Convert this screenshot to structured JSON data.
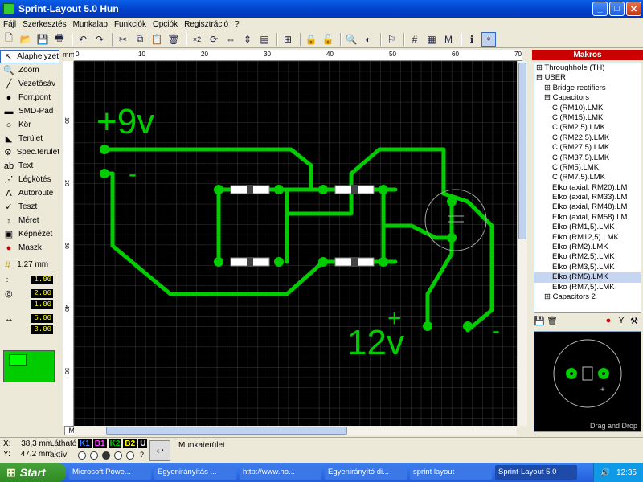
{
  "window": {
    "title": "Sprint-Layout 5.0 Hun",
    "min": "_",
    "max": "□",
    "close": "✕"
  },
  "menu": [
    "Fájl",
    "Szerkesztés",
    "Munkalap",
    "Funkciók",
    "Opciók",
    "Regisztráció",
    "?"
  ],
  "toolbar": {
    "icons": [
      "new-icon",
      "open-icon",
      "save-icon",
      "print-icon",
      "sep",
      "undo-icon",
      "redo-icon",
      "sep",
      "cut-icon",
      "copy-icon",
      "paste-icon",
      "delete-icon",
      "sep",
      "duplicate-icon",
      "rotate-icon",
      "mirror-h-icon",
      "mirror-v-icon",
      "align-icon",
      "sep",
      "group-icon",
      "sep",
      "lock-icon",
      "unlock-icon",
      "sep",
      "zoom-icon",
      "contrast-icon",
      "sep",
      "drc-icon",
      "sep",
      "grid-icon",
      "drc-report-icon",
      "layer-icon",
      "sep",
      "info-icon",
      "connect-icon"
    ],
    "x2_label": "×2"
  },
  "tools": [
    {
      "label": "Alaphelyzet",
      "icon": "pointer-icon",
      "glyph": "↖"
    },
    {
      "label": "Zoom",
      "icon": "zoom-tool-icon",
      "glyph": "🔍"
    },
    {
      "label": "Vezetősáv",
      "icon": "track-icon",
      "glyph": "╱"
    },
    {
      "label": "Forr.pont",
      "icon": "pad-icon",
      "glyph": "●"
    },
    {
      "label": "SMD-Pad",
      "icon": "smd-icon",
      "glyph": "▬"
    },
    {
      "label": "Kör",
      "icon": "circle-icon",
      "glyph": "○"
    },
    {
      "label": "Terület",
      "icon": "area-icon",
      "glyph": "◣"
    },
    {
      "label": "Spec.terület",
      "icon": "special-area-icon",
      "glyph": "⚙"
    },
    {
      "label": "Text",
      "icon": "text-icon",
      "glyph": "ab"
    },
    {
      "label": "Légkötés",
      "icon": "airwire-icon",
      "glyph": "⋰"
    },
    {
      "label": "Autoroute",
      "icon": "autoroute-icon",
      "glyph": "A"
    },
    {
      "label": "Teszt",
      "icon": "test-icon",
      "glyph": "✓"
    },
    {
      "label": "Méret",
      "icon": "measure-icon",
      "glyph": "↕"
    },
    {
      "label": "Képnézet",
      "icon": "photo-icon",
      "glyph": "▣"
    },
    {
      "label": "Maszk",
      "icon": "mask-icon",
      "glyph": "●"
    }
  ],
  "settings": {
    "grid": "1,27 mm",
    "track_width": "1.00",
    "pad_outer": "2.00",
    "pad_inner": "1.00",
    "smd_w": "5.00",
    "smd_h": "3.00"
  },
  "ruler": {
    "unit": "mm",
    "ticks": [
      "0",
      "10",
      "20",
      "30",
      "40",
      "50",
      "60",
      "70"
    ],
    "left_ticks": [
      "10",
      "20",
      "30",
      "40",
      "50"
    ]
  },
  "board": {
    "text_9v": "+9v",
    "text_12v": "12v",
    "plus": "+",
    "minus": "-"
  },
  "tab": "Munkalap",
  "macros": {
    "title": "Makros",
    "tree": [
      {
        "t": "⊞ Throughhole (TH)",
        "lvl": 0
      },
      {
        "t": "⊟ USER",
        "lvl": 0
      },
      {
        "t": "⊞ Bridge rectifiers",
        "lvl": 1
      },
      {
        "t": "⊟ Capacitors",
        "lvl": 1
      },
      {
        "t": "C (RM10).LMK",
        "lvl": 2
      },
      {
        "t": "C (RM15).LMK",
        "lvl": 2
      },
      {
        "t": "C (RM2,5).LMK",
        "lvl": 2
      },
      {
        "t": "C (RM22,5).LMK",
        "lvl": 2
      },
      {
        "t": "C (RM27,5).LMK",
        "lvl": 2
      },
      {
        "t": "C (RM37,5).LMK",
        "lvl": 2
      },
      {
        "t": "C (RM5).LMK",
        "lvl": 2
      },
      {
        "t": "C (RM7,5).LMK",
        "lvl": 2
      },
      {
        "t": "Elko (axial, RM20).LM",
        "lvl": 2
      },
      {
        "t": "Elko (axial, RM33).LM",
        "lvl": 2
      },
      {
        "t": "Elko (axial, RM48).LM",
        "lvl": 2
      },
      {
        "t": "Elko (axial, RM58).LM",
        "lvl": 2
      },
      {
        "t": "Elko (RM1,5).LMK",
        "lvl": 2
      },
      {
        "t": "Elko (RM12,5).LMK",
        "lvl": 2
      },
      {
        "t": "Elko (RM2).LMK",
        "lvl": 2
      },
      {
        "t": "Elko (RM2,5).LMK",
        "lvl": 2
      },
      {
        "t": "Elko (RM3,5).LMK",
        "lvl": 2
      },
      {
        "t": "Elko (RM5).LMK",
        "lvl": 2,
        "sel": true
      },
      {
        "t": "Elko (RM7,5).LMK",
        "lvl": 2
      },
      {
        "t": "⊞ Capacitors 2",
        "lvl": 1
      }
    ],
    "preview_hint": "Drag and Drop"
  },
  "status": {
    "x_label": "X:",
    "x_val": "38,3 mm",
    "y_label": "Y:",
    "y_val": "47,2 mm",
    "visible_label": "Látható",
    "active_label": "aktív",
    "layers": [
      "K1",
      "B1",
      "K2",
      "B2",
      "U"
    ],
    "workspace": "Munkaterület",
    "help": "?"
  },
  "taskbar": {
    "start": "Start",
    "tasks": [
      "Microsoft Powe...",
      "Egyenirányítás ...",
      "http://www.ho...",
      "Egyenirányító di...",
      "sprint layout",
      "Sprint-Layout 5.0"
    ],
    "clock": "12:35"
  },
  "colors": {
    "track": "#00cc00",
    "board_bg": "#000000",
    "grid": "#333333",
    "accent": "#316ac5"
  }
}
